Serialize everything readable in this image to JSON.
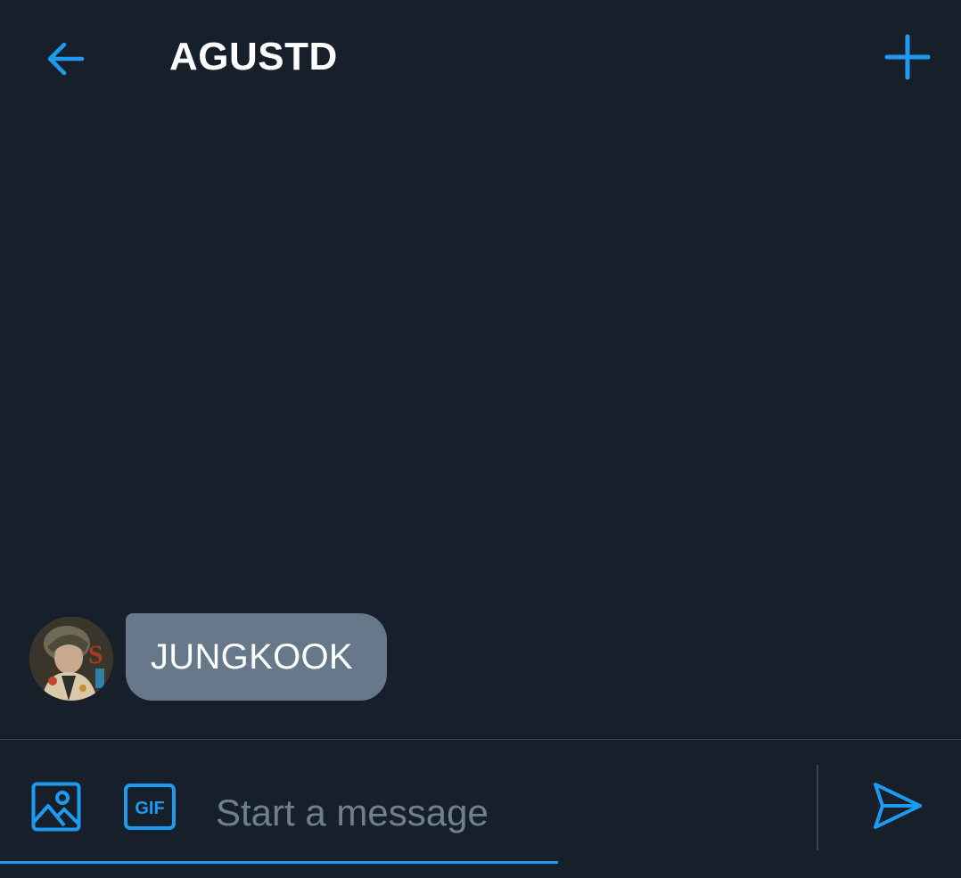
{
  "header": {
    "title": "AGUSTD"
  },
  "icons": {
    "back": "arrow-left-icon",
    "add": "plus-icon",
    "media": "image-icon",
    "gif": "gif-icon",
    "send": "send-icon"
  },
  "messages": [
    {
      "sender_avatar": "avatar",
      "text": "JUNGKOOK"
    }
  ],
  "compose": {
    "placeholder": "Start a message",
    "gif_label": "GIF"
  },
  "colors": {
    "background": "#17202a",
    "accent": "#1d9bf0",
    "bubble": "#66788a",
    "placeholder": "#6e7f8f",
    "divider": "#38444d"
  }
}
